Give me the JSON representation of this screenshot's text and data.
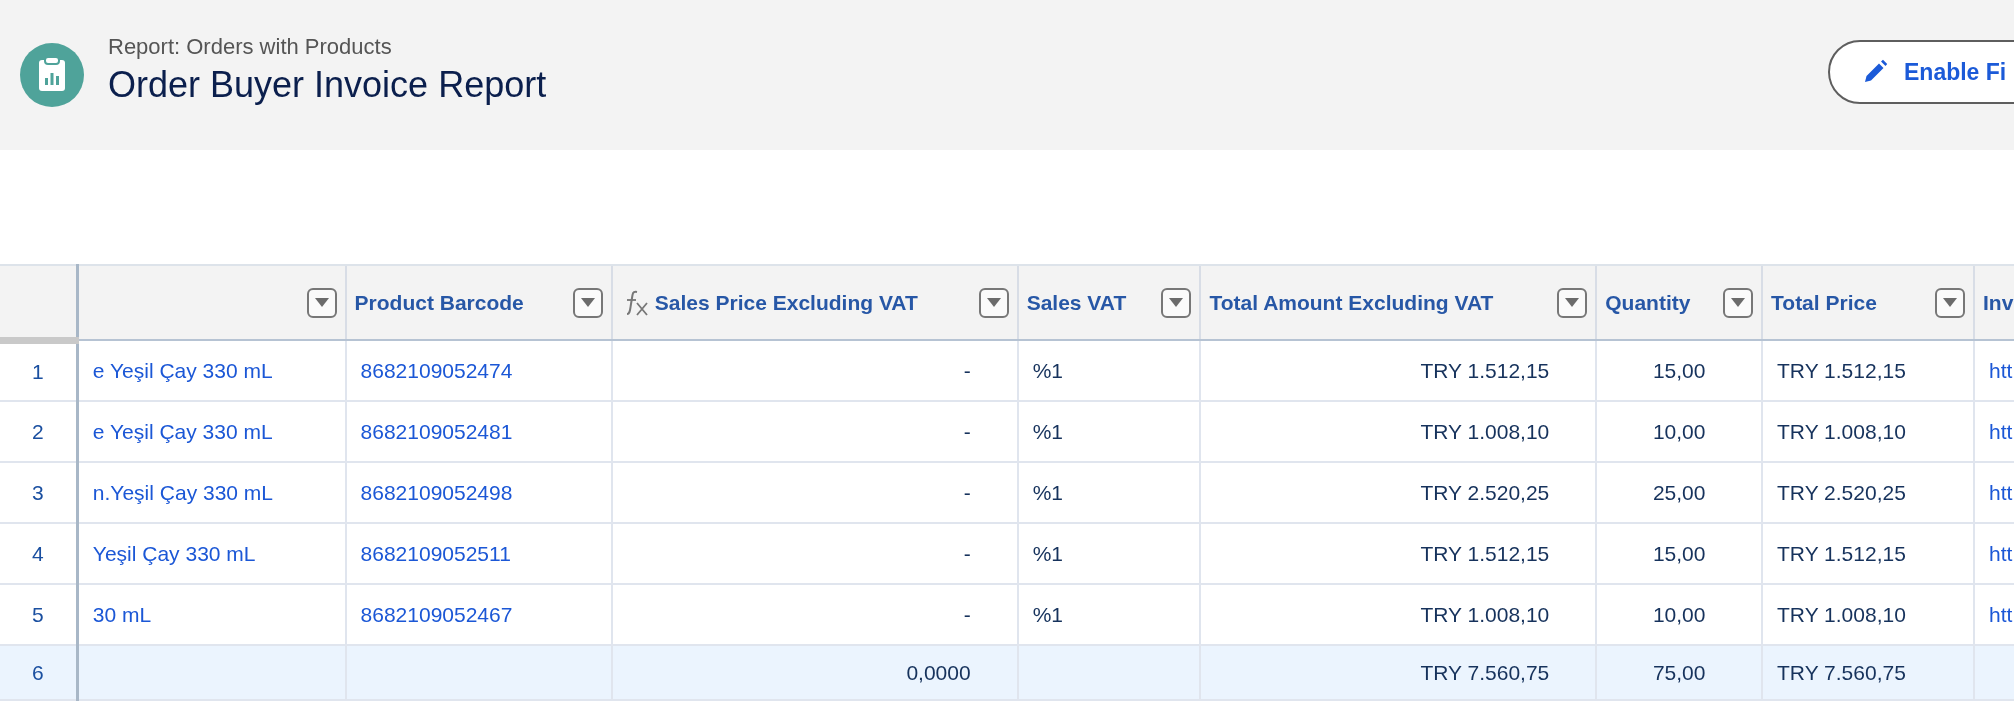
{
  "header": {
    "subtitle": "Report: Orders with Products",
    "title": "Order Buyer Invoice Report",
    "button": "Enable Fi"
  },
  "table": {
    "columns": [
      {
        "kind": "link",
        "filter": true,
        "formula": false
      },
      {
        "label": "Product Barcode",
        "kind": "link",
        "filter": true,
        "formula": false
      },
      {
        "label": "Sales Price Excluding VAT",
        "kind": "text",
        "filter": true,
        "formula": true
      },
      {
        "label": "Sales VAT",
        "kind": "text",
        "filter": true,
        "formula": false
      },
      {
        "label": "Total Amount Excluding VAT",
        "kind": "text",
        "filter": true,
        "formula": false
      },
      {
        "label": "Quantity",
        "kind": "text",
        "filter": true,
        "formula": false
      },
      {
        "label": "Total Price",
        "kind": "text",
        "filter": true,
        "formula": false
      },
      {
        "label": "Inv",
        "kind": "link",
        "formula": false
      }
    ],
    "rows": [
      {
        "number": "1",
        "total": false,
        "cells": [
          "e Yeşil Çay 330 mL",
          "8682109052474",
          "-",
          "%1",
          "TRY 1.512,15",
          "15,00",
          "TRY 1.512,15",
          "htt"
        ]
      },
      {
        "number": "2",
        "total": false,
        "cells": [
          "e Yeşil Çay 330 mL",
          "8682109052481",
          "-",
          "%1",
          "TRY 1.008,10",
          "10,00",
          "TRY 1.008,10",
          "htt"
        ]
      },
      {
        "number": "3",
        "total": false,
        "cells": [
          "n.Yeşil Çay 330 mL",
          "8682109052498",
          "-",
          "%1",
          "TRY 2.520,25",
          "25,00",
          "TRY 2.520,25",
          "htt"
        ]
      },
      {
        "number": "4",
        "total": false,
        "cells": [
          "Yeşil Çay 330 mL",
          "8682109052511",
          "-",
          "%1",
          "TRY 1.512,15",
          "15,00",
          "TRY 1.512,15",
          "htt"
        ]
      },
      {
        "number": "5",
        "total": false,
        "cells": [
          "30 mL",
          "8682109052467",
          "-",
          "%1",
          "TRY 1.008,10",
          "10,00",
          "TRY 1.008,10",
          "htt"
        ]
      },
      {
        "number": "6",
        "total": true,
        "cells": [
          null,
          null,
          "0,0000",
          null,
          "TRY 7.560,75",
          "75,00",
          "TRY 7.560,75",
          null
        ]
      }
    ]
  }
}
